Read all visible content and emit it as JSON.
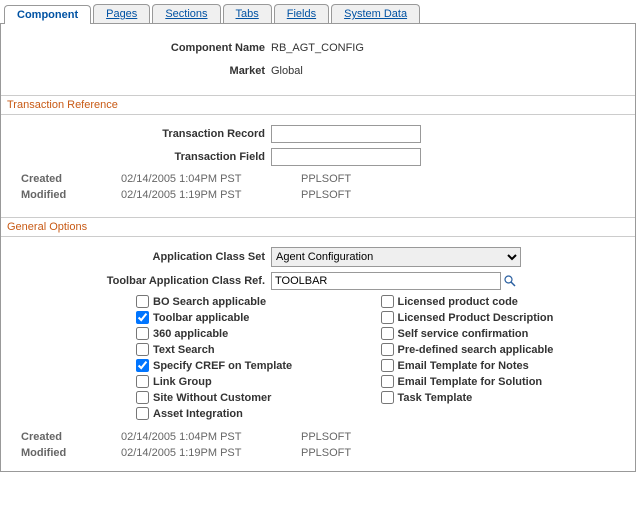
{
  "tabs": {
    "component": "Component",
    "pages": "Pages",
    "sections": "Sections",
    "tabs_": "Tabs",
    "fields": "Fields",
    "system_data": "System Data"
  },
  "header": {
    "component_name_label": "Component Name",
    "component_name_value": "RB_AGT_CONFIG",
    "market_label": "Market",
    "market_value": "Global"
  },
  "transaction_reference": {
    "title": "Transaction Reference",
    "record_label": "Transaction Record",
    "record_value": "",
    "field_label": "Transaction Field",
    "field_value": "",
    "created_label": "Created",
    "created_date": "02/14/2005  1:04PM PST",
    "created_user": "PPLSOFT",
    "modified_label": "Modified",
    "modified_date": "02/14/2005  1:19PM PST",
    "modified_user": "PPLSOFT"
  },
  "general_options": {
    "title": "General Options",
    "app_class_set_label": "Application Class Set",
    "app_class_set_value": "Agent Configuration",
    "toolbar_ref_label": "Toolbar Application Class Ref.",
    "toolbar_ref_value": "TOOLBAR",
    "checkboxes_left": [
      {
        "label": "BO Search applicable",
        "checked": false
      },
      {
        "label": "Toolbar applicable",
        "checked": true
      },
      {
        "label": "360 applicable",
        "checked": false
      },
      {
        "label": "Text Search",
        "checked": false
      },
      {
        "label": "Specify CREF on Template",
        "checked": true
      },
      {
        "label": "Link Group",
        "checked": false
      },
      {
        "label": "Site Without Customer",
        "checked": false
      },
      {
        "label": "Asset Integration",
        "checked": false
      }
    ],
    "checkboxes_right": [
      {
        "label": "Licensed product code",
        "checked": false
      },
      {
        "label": "Licensed Product Description",
        "checked": false
      },
      {
        "label": "Self service confirmation",
        "checked": false
      },
      {
        "label": "Pre-defined search applicable",
        "checked": false
      },
      {
        "label": "Email Template for Notes",
        "checked": false
      },
      {
        "label": "Email Template for Solution",
        "checked": false
      },
      {
        "label": "Task Template",
        "checked": false
      }
    ],
    "created_label": "Created",
    "created_date": "02/14/2005  1:04PM PST",
    "created_user": "PPLSOFT",
    "modified_label": "Modified",
    "modified_date": "02/14/2005  1:19PM PST",
    "modified_user": "PPLSOFT"
  }
}
